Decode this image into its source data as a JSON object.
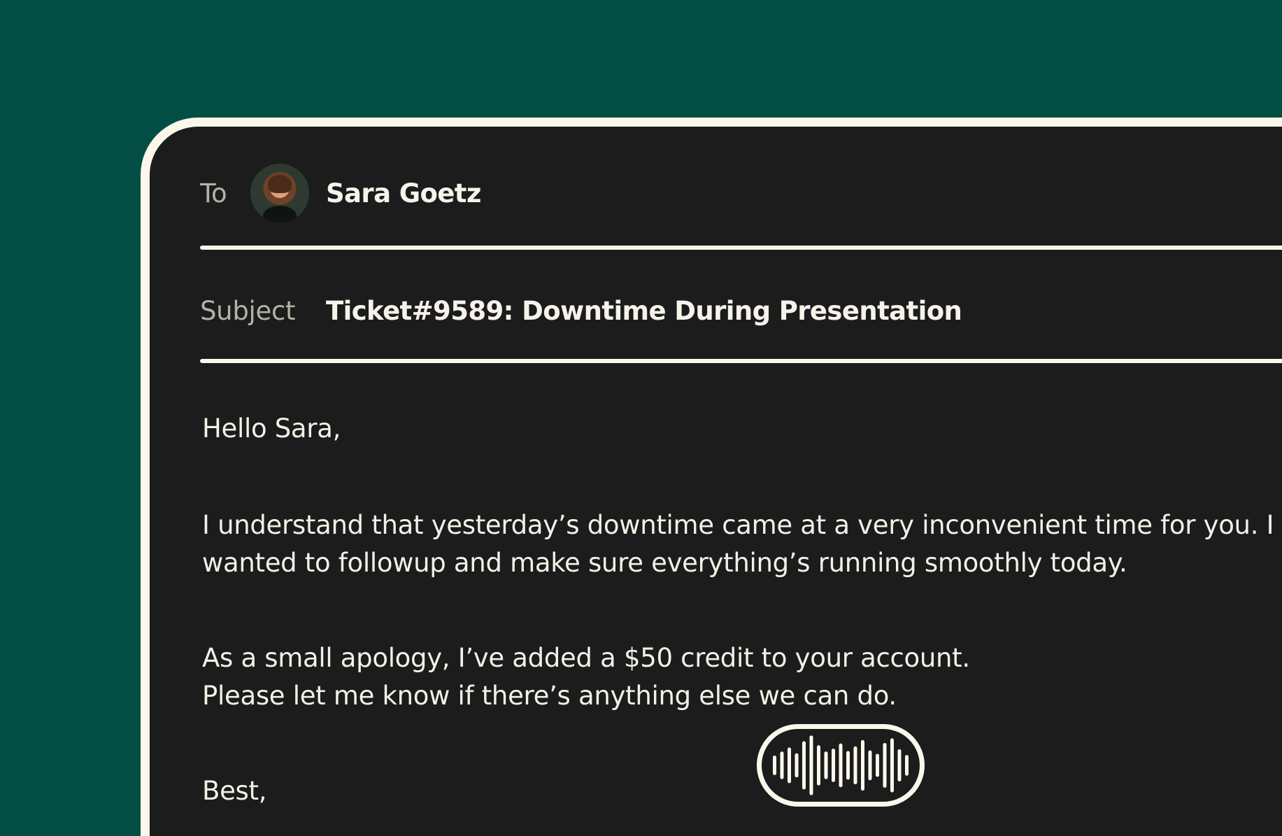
{
  "compose": {
    "to_label": "To",
    "recipient_name": "Sara Goetz",
    "subject_label": "Subject",
    "subject_value": "Ticket#9589: Downtime During Presentation"
  },
  "message": {
    "greeting": "Hello Sara,",
    "paragraph1_line1": "I understand that yesterday’s downtime came at a very inconvenient time for you. I",
    "paragraph1_line2": "wanted to followup and make sure everything’s running smoothly today.",
    "paragraph2_line1": "As a small apology, I’ve added a $50 credit to your account.",
    "paragraph2_line2": "Please let me know if there’s anything else we can do.",
    "signoff": "Best,"
  },
  "voice_input": {
    "icon": "waveform-icon",
    "bar_levels": [
      0.28,
      0.42,
      0.56,
      0.36,
      0.78,
      0.98,
      0.64,
      0.42,
      0.52,
      0.7,
      0.44,
      0.6,
      0.82,
      0.46,
      0.34,
      0.72,
      0.88,
      0.5,
      0.3
    ]
  },
  "colors": {
    "background": "#024D44",
    "card": "#1C1C1C",
    "outline": "#FBF8EB",
    "label": "#B4B2A7",
    "text": "#F3F0E6"
  }
}
